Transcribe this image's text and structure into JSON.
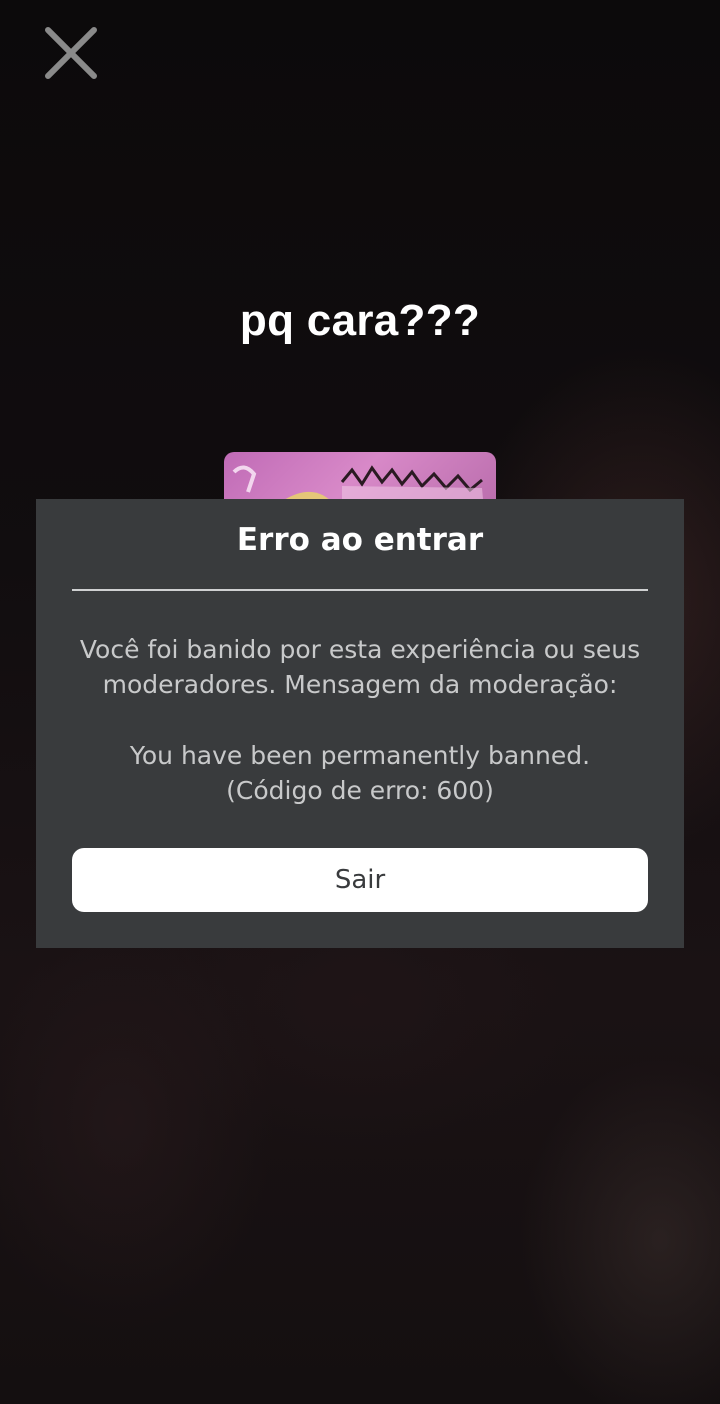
{
  "caption": "pq cara???",
  "close_icon": "close-icon",
  "dialog": {
    "title": "Erro ao entrar",
    "message_line1": "Você foi banido por esta experiência ou seus",
    "message_line2": "moderadores. Mensagem da moderação:",
    "message_line3": "You have been permanently banned.",
    "message_line4": "(Código de erro: 600)",
    "button_label": "Sair"
  },
  "colors": {
    "dialog_bg": "#393b3d",
    "button_bg": "#ffffff",
    "text_primary": "#ffffff",
    "text_secondary": "#c8c9ca",
    "thumbnail_accent": "#c06bb6"
  }
}
